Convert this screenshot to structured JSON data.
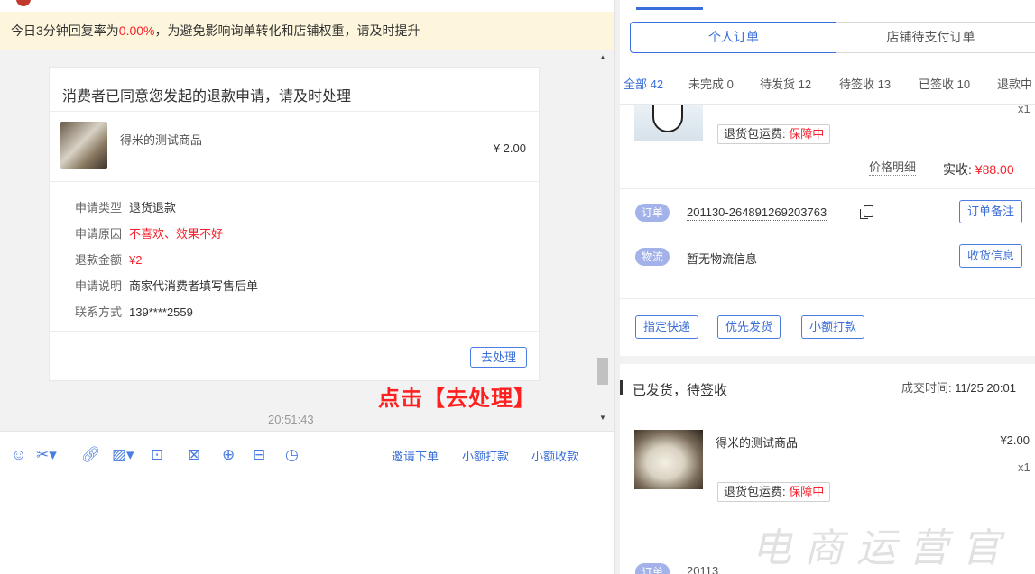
{
  "notice": {
    "prefix": "今日3分钟回复率为",
    "rate": "0.00%",
    "suffix": "，为避免影响询单转化和店铺权重，请及时提升"
  },
  "card": {
    "title": "消费者已同意您发起的退款申请，请及时处理",
    "product_name": "得米的测试商品",
    "product_price": "¥ 2.00",
    "fields": [
      {
        "label": "申请类型",
        "value": "退货退款"
      },
      {
        "label": "申请原因",
        "value": "不喜欢、效果不好"
      },
      {
        "label": "退款金额",
        "value": "¥2"
      },
      {
        "label": "申请说明",
        "value": "商家代消费者填写售后单"
      },
      {
        "label": "联系方式",
        "value": "139****2559"
      }
    ],
    "action_label": "去处理"
  },
  "annotation": "点击【去处理】",
  "message_time": "20:51:43",
  "toolbar": {
    "links": [
      "邀请下单",
      "小额打款",
      "小额收款"
    ],
    "icons": [
      "emoji-icon",
      "scissors-icon",
      "link-icon",
      "image-icon",
      "video-icon",
      "coupon-icon",
      "search-icon",
      "folder-icon",
      "clock-icon"
    ]
  },
  "right": {
    "segments": {
      "personal": "个人订单",
      "shop": "店铺待支付订单"
    },
    "filters": [
      "全部 42",
      "未完成 0",
      "待发货 12",
      "待签收 13",
      "已签收 10",
      "退款中"
    ],
    "order1": {
      "qty": "x1",
      "ship_fee_label": "退货包运费: ",
      "ship_fee_value": "保障中",
      "price_detail": "价格明细",
      "paid_label": "实收: ",
      "paid_value": "¥88.00",
      "order_tag": "订单",
      "order_no": "201130-264891269203763",
      "remark_btn": "订单备注",
      "logistics_tag": "物流",
      "logistics_text": "暂无物流信息",
      "receive_btn": "收货信息",
      "actions": [
        "指定快递",
        "优先发货",
        "小额打款"
      ]
    },
    "order2": {
      "status": "已发货，待签收",
      "deal_time_label": "成交时间: ",
      "deal_time_value": "11/25 20:01",
      "product_name": "得米的测试商品",
      "price": "¥2.00",
      "qty": "x1",
      "ship_fee_label": "退货包运费: ",
      "ship_fee_value": "保障中",
      "order_tag": "订单",
      "order_no_frag": "20113"
    }
  },
  "watermark": "电商运营官"
}
